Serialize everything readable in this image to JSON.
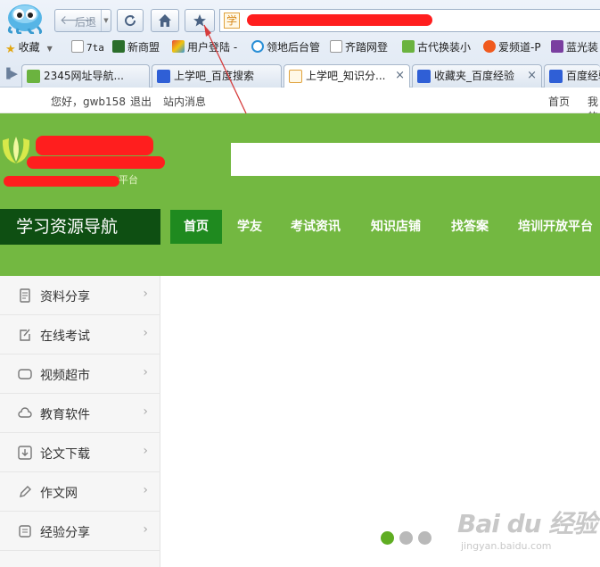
{
  "browser": {
    "back_label": "后退",
    "address_site_icon": "学",
    "bookmarks": [
      "收藏",
      "7ta",
      "新商盟",
      "用户登陆 -",
      "领地后台管",
      "齐踏网登",
      "古代换装小",
      "爱频道-P",
      "蓝光装"
    ],
    "tabs": [
      {
        "label": "2345网址导航...",
        "active": false
      },
      {
        "label": "上学吧_百度搜索",
        "active": false
      },
      {
        "label": "上学吧_知识分...",
        "active": true
      },
      {
        "label": "收藏夹_百度经验",
        "active": false
      },
      {
        "label": "百度经验",
        "active": false
      }
    ],
    "icons": {
      "back": "back-arrow-icon",
      "refresh": "refresh-icon",
      "home": "home-icon",
      "favorite": "star-icon",
      "close": "close-icon"
    }
  },
  "userbar": {
    "greeting": "您好，gwb158",
    "logout": "退出",
    "messages": "站内消息",
    "home": "首页",
    "mine": "我的"
  },
  "header": {
    "brand_tagline_visible": "平台",
    "nav_title": "学习资源导航",
    "nav": [
      "首页",
      "学友",
      "考试资讯",
      "知识店铺",
      "找答案",
      "培训开放平台"
    ]
  },
  "sidebar": {
    "items": [
      {
        "label": "资料分享",
        "icon": "document-icon"
      },
      {
        "label": "在线考试",
        "icon": "edit-icon"
      },
      {
        "label": "视频超市",
        "icon": "video-icon"
      },
      {
        "label": "教育软件",
        "icon": "cloud-icon"
      },
      {
        "label": "论文下载",
        "icon": "download-icon"
      },
      {
        "label": "作文网",
        "icon": "pen-icon"
      },
      {
        "label": "经验分享",
        "icon": "note-icon"
      }
    ],
    "chevron": "›"
  },
  "carousel": {
    "count": 3,
    "active_index": 0
  },
  "watermark": {
    "brand": "Bai du 经验",
    "url": "jingyan.baidu.com"
  },
  "colors": {
    "header_green": "#73b841",
    "nav_title_bg": "#0e4f12",
    "nav_active": "#1f8a1f",
    "redaction": "#ff1e1e"
  }
}
